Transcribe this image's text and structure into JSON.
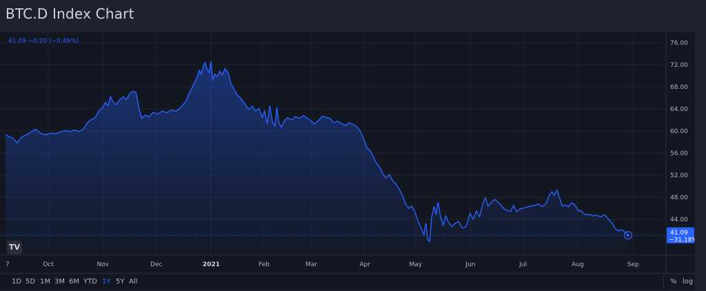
{
  "page": {
    "title": "BTC.D Index Chart"
  },
  "legend": {
    "text": "41.09 −0.20 (−0.49%)"
  },
  "logo": {
    "text": "TV"
  },
  "toolbar": {
    "ranges": [
      {
        "label": "1D",
        "active": false
      },
      {
        "label": "5D",
        "active": false
      },
      {
        "label": "1M",
        "active": false
      },
      {
        "label": "3M",
        "active": false
      },
      {
        "label": "6M",
        "active": false
      },
      {
        "label": "YTD",
        "active": false
      },
      {
        "label": "1Y",
        "active": true
      },
      {
        "label": "5Y",
        "active": false
      },
      {
        "label": "All",
        "active": false
      }
    ],
    "percent_label": "%",
    "log_label": "log"
  },
  "colors": {
    "line": "#2962ff",
    "badge": "#2962ff",
    "grid": "#1e2230",
    "background": "#131722"
  },
  "chart_data": {
    "type": "area",
    "title": "BTC.D Index Chart",
    "xlabel": "",
    "ylabel": "",
    "ylim": [
      37.5,
      78
    ],
    "y_ticks": [
      44,
      48,
      52,
      56,
      60,
      64,
      68,
      72,
      76
    ],
    "y_tick_labels": [
      "44.00",
      "48.00",
      "52.00",
      "56.00",
      "60.00",
      "64.00",
      "68.00",
      "72.00",
      "76.00"
    ],
    "x_tick_labels": [
      {
        "label": "7",
        "t": 0
      },
      {
        "label": "Oct",
        "t": 0.0668
      },
      {
        "label": "Nov",
        "t": 0.1522
      },
      {
        "label": "Dec",
        "t": 0.2357
      },
      {
        "label": "2021",
        "t": 0.3215,
        "year": true
      },
      {
        "label": "Feb",
        "t": 0.4041
      },
      {
        "label": "Mar",
        "t": 0.478
      },
      {
        "label": "Apr",
        "t": 0.5617
      },
      {
        "label": "May",
        "t": 0.641
      },
      {
        "label": "Jun",
        "t": 0.7267
      },
      {
        "label": "Jul",
        "t": 0.809
      },
      {
        "label": "Aug",
        "t": 0.8945
      },
      {
        "label": "Sep",
        "t": 0.981
      }
    ],
    "grid": true,
    "last_value": {
      "value": 41.09,
      "label": "41.09",
      "change_label": "−31.18%"
    },
    "series": [
      {
        "values": [
          [
            0.0,
            59.4
          ],
          [
            0.005,
            59.0
          ],
          [
            0.012,
            58.7
          ],
          [
            0.018,
            57.8
          ],
          [
            0.025,
            58.9
          ],
          [
            0.032,
            59.3
          ],
          [
            0.04,
            59.8
          ],
          [
            0.047,
            60.3
          ],
          [
            0.055,
            59.6
          ],
          [
            0.062,
            59.3
          ],
          [
            0.07,
            59.6
          ],
          [
            0.078,
            59.5
          ],
          [
            0.085,
            59.8
          ],
          [
            0.093,
            60.1
          ],
          [
            0.1,
            59.9
          ],
          [
            0.108,
            60.2
          ],
          [
            0.115,
            59.9
          ],
          [
            0.122,
            60.4
          ],
          [
            0.128,
            61.5
          ],
          [
            0.133,
            62.0
          ],
          [
            0.14,
            62.4
          ],
          [
            0.146,
            63.7
          ],
          [
            0.152,
            64.3
          ],
          [
            0.156,
            65.2
          ],
          [
            0.16,
            64.6
          ],
          [
            0.164,
            66.2
          ],
          [
            0.168,
            65.3
          ],
          [
            0.173,
            64.8
          ],
          [
            0.178,
            65.6
          ],
          [
            0.184,
            66.2
          ],
          [
            0.189,
            65.7
          ],
          [
            0.194,
            66.8
          ],
          [
            0.199,
            67.2
          ],
          [
            0.204,
            67.0
          ],
          [
            0.209,
            63.9
          ],
          [
            0.213,
            62.3
          ],
          [
            0.218,
            62.9
          ],
          [
            0.224,
            62.6
          ],
          [
            0.231,
            63.4
          ],
          [
            0.238,
            63.1
          ],
          [
            0.245,
            63.6
          ],
          [
            0.252,
            63.3
          ],
          [
            0.259,
            63.8
          ],
          [
            0.266,
            63.6
          ],
          [
            0.272,
            64.1
          ],
          [
            0.277,
            64.7
          ],
          [
            0.282,
            65.4
          ],
          [
            0.287,
            66.8
          ],
          [
            0.291,
            67.7
          ],
          [
            0.295,
            68.7
          ],
          [
            0.299,
            69.7
          ],
          [
            0.303,
            71.0
          ],
          [
            0.306,
            70.3
          ],
          [
            0.309,
            71.8
          ],
          [
            0.312,
            72.4
          ],
          [
            0.315,
            71.2
          ],
          [
            0.318,
            70.6
          ],
          [
            0.321,
            72.6
          ],
          [
            0.324,
            69.3
          ],
          [
            0.327,
            70.3
          ],
          [
            0.331,
            69.9
          ],
          [
            0.335,
            70.8
          ],
          [
            0.339,
            70.2
          ],
          [
            0.343,
            71.3
          ],
          [
            0.348,
            70.6
          ],
          [
            0.352,
            68.7
          ],
          [
            0.357,
            67.6
          ],
          [
            0.362,
            66.6
          ],
          [
            0.367,
            66.0
          ],
          [
            0.373,
            65.1
          ],
          [
            0.38,
            63.9
          ],
          [
            0.386,
            64.5
          ],
          [
            0.391,
            63.6
          ],
          [
            0.396,
            64.1
          ],
          [
            0.401,
            62.5
          ],
          [
            0.405,
            63.6
          ],
          [
            0.409,
            61.3
          ],
          [
            0.413,
            64.6
          ],
          [
            0.417,
            61.7
          ],
          [
            0.421,
            60.9
          ],
          [
            0.424,
            64.3
          ],
          [
            0.427,
            61.5
          ],
          [
            0.431,
            60.7
          ],
          [
            0.436,
            61.9
          ],
          [
            0.441,
            62.4
          ],
          [
            0.447,
            62.0
          ],
          [
            0.453,
            62.6
          ],
          [
            0.459,
            62.3
          ],
          [
            0.465,
            62.8
          ],
          [
            0.471,
            62.4
          ],
          [
            0.477,
            61.9
          ],
          [
            0.483,
            61.3
          ],
          [
            0.489,
            61.9
          ],
          [
            0.495,
            62.7
          ],
          [
            0.501,
            62.5
          ],
          [
            0.507,
            62.3
          ],
          [
            0.513,
            61.5
          ],
          [
            0.519,
            61.8
          ],
          [
            0.525,
            61.4
          ],
          [
            0.531,
            61.0
          ],
          [
            0.537,
            61.5
          ],
          [
            0.543,
            61.2
          ],
          [
            0.549,
            60.8
          ],
          [
            0.555,
            59.9
          ],
          [
            0.56,
            58.4
          ],
          [
            0.565,
            57.0
          ],
          [
            0.57,
            56.4
          ],
          [
            0.575,
            55.3
          ],
          [
            0.58,
            54.1
          ],
          [
            0.585,
            53.4
          ],
          [
            0.59,
            52.2
          ],
          [
            0.595,
            51.5
          ],
          [
            0.6,
            52.1
          ],
          [
            0.605,
            51.0
          ],
          [
            0.61,
            50.4
          ],
          [
            0.615,
            49.5
          ],
          [
            0.62,
            48.4
          ],
          [
            0.625,
            46.8
          ],
          [
            0.63,
            46.0
          ],
          [
            0.635,
            46.4
          ],
          [
            0.64,
            45.3
          ],
          [
            0.645,
            43.6
          ],
          [
            0.65,
            42.3
          ],
          [
            0.654,
            41.2
          ],
          [
            0.657,
            43.3
          ],
          [
            0.66,
            40.3
          ],
          [
            0.663,
            40.0
          ],
          [
            0.666,
            44.4
          ],
          [
            0.67,
            46.3
          ],
          [
            0.673,
            44.8
          ],
          [
            0.676,
            47.1
          ],
          [
            0.68,
            44.5
          ],
          [
            0.684,
            42.9
          ],
          [
            0.688,
            44.6
          ],
          [
            0.692,
            43.5
          ],
          [
            0.697,
            42.7
          ],
          [
            0.702,
            43.2
          ],
          [
            0.708,
            43.6
          ],
          [
            0.714,
            42.4
          ],
          [
            0.72,
            42.7
          ],
          [
            0.726,
            45.1
          ],
          [
            0.731,
            44.0
          ],
          [
            0.736,
            45.5
          ],
          [
            0.741,
            44.5
          ],
          [
            0.746,
            46.8
          ],
          [
            0.75,
            47.9
          ],
          [
            0.754,
            46.4
          ],
          [
            0.759,
            47.0
          ],
          [
            0.764,
            47.6
          ],
          [
            0.769,
            47.2
          ],
          [
            0.774,
            46.6
          ],
          [
            0.779,
            45.9
          ],
          [
            0.784,
            45.6
          ],
          [
            0.789,
            45.4
          ],
          [
            0.794,
            46.5
          ],
          [
            0.799,
            45.3
          ],
          [
            0.804,
            45.9
          ],
          [
            0.809,
            46.0
          ],
          [
            0.815,
            46.2
          ],
          [
            0.821,
            46.4
          ],
          [
            0.827,
            46.5
          ],
          [
            0.833,
            46.8
          ],
          [
            0.839,
            46.3
          ],
          [
            0.845,
            46.9
          ],
          [
            0.85,
            48.4
          ],
          [
            0.854,
            49.0
          ],
          [
            0.858,
            48.4
          ],
          [
            0.862,
            49.3
          ],
          [
            0.866,
            47.9
          ],
          [
            0.87,
            46.4
          ],
          [
            0.875,
            46.6
          ],
          [
            0.88,
            46.3
          ],
          [
            0.885,
            47.0
          ],
          [
            0.89,
            46.6
          ],
          [
            0.895,
            45.6
          ],
          [
            0.9,
            45.5
          ],
          [
            0.906,
            44.8
          ],
          [
            0.912,
            44.9
          ],
          [
            0.918,
            44.6
          ],
          [
            0.924,
            44.8
          ],
          [
            0.93,
            44.4
          ],
          [
            0.936,
            44.8
          ],
          [
            0.942,
            44.1
          ],
          [
            0.948,
            43.3
          ],
          [
            0.953,
            42.3
          ],
          [
            0.958,
            41.9
          ],
          [
            0.963,
            42.1
          ],
          [
            0.968,
            41.7
          ],
          [
            0.973,
            41.2
          ]
        ]
      }
    ]
  }
}
